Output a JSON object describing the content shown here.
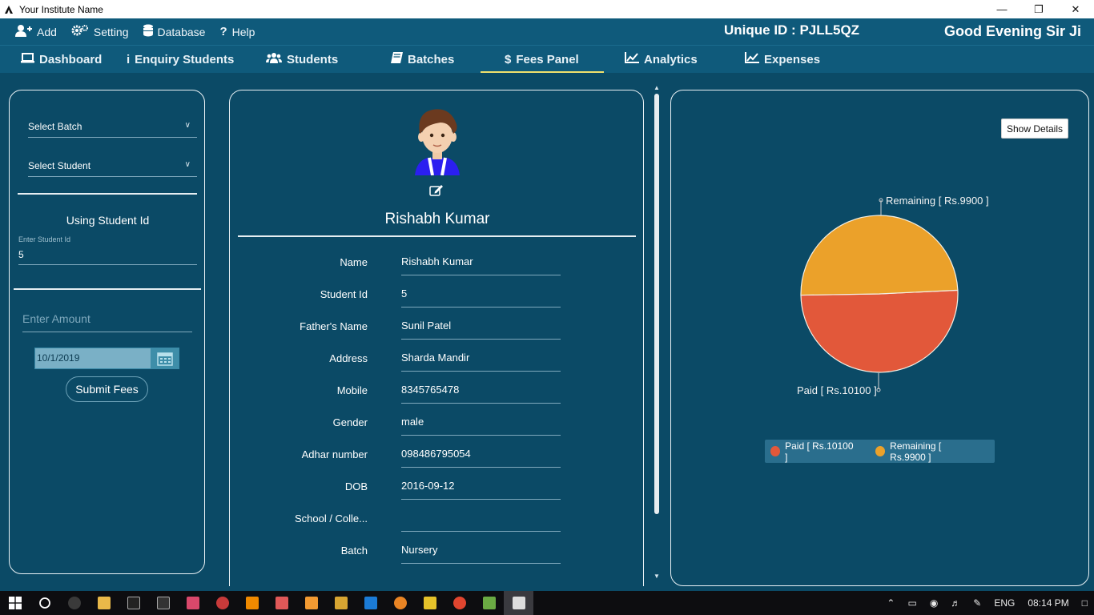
{
  "window": {
    "title": "Your Institute Name",
    "minimize": "—",
    "maximize": "❐",
    "close": "✕"
  },
  "menu": {
    "add": "Add",
    "setting": "Setting",
    "database": "Database",
    "help": "Help",
    "unique_id": "Unique ID : PJLL5QZ",
    "greeting": "Good Evening Sir Ji"
  },
  "tabs": [
    {
      "label": "Dashboard",
      "icon": "laptop-icon"
    },
    {
      "label": "Enquiry Students",
      "icon": "info-icon"
    },
    {
      "label": "Students",
      "icon": "users-icon"
    },
    {
      "label": "Batches",
      "icon": "book-icon"
    },
    {
      "label": "Fees Panel",
      "icon": "dollar-icon",
      "active": true
    },
    {
      "label": "Analytics",
      "icon": "line-chart-icon"
    },
    {
      "label": "Expenses",
      "icon": "area-chart-icon"
    }
  ],
  "left": {
    "select_batch": "Select Batch",
    "select_student": "Select Student",
    "using_student_id": "Using Student Id",
    "enter_student_id_label": "Enter Student Id",
    "student_id_value": "5",
    "amount_placeholder": "Enter Amount",
    "date_value": "10/1/2019",
    "submit_label": "Submit Fees"
  },
  "student": {
    "title": "Rishabh Kumar",
    "fields": [
      {
        "label": "Name",
        "value": "Rishabh Kumar"
      },
      {
        "label": "Student Id",
        "value": "5"
      },
      {
        "label": "Father's Name",
        "value": "Sunil Patel"
      },
      {
        "label": "Address",
        "value": "Sharda Mandir"
      },
      {
        "label": "Mobile",
        "value": "8345765478"
      },
      {
        "label": "Gender",
        "value": "male"
      },
      {
        "label": "Adhar number",
        "value": "098486795054"
      },
      {
        "label": "DOB",
        "value": "2016-09-12"
      },
      {
        "label": "School / Colle...",
        "value": ""
      },
      {
        "label": "Batch",
        "value": "Nursery"
      }
    ]
  },
  "right": {
    "show_details": "Show Details",
    "remaining_label": "Remaining [ Rs.9900 ]",
    "paid_label": "Paid [ Rs.10100 ]"
  },
  "chart_data": {
    "type": "pie",
    "slices": [
      {
        "name": "Paid [ Rs.10100 ]",
        "value": 10100,
        "color": "#e2583a"
      },
      {
        "name": "Remaining [ Rs.9900 ]",
        "value": 9900,
        "color": "#eba12a"
      }
    ],
    "legend": "bottom"
  },
  "taskbar": {
    "language": "ENG",
    "time": "08:14 PM"
  }
}
